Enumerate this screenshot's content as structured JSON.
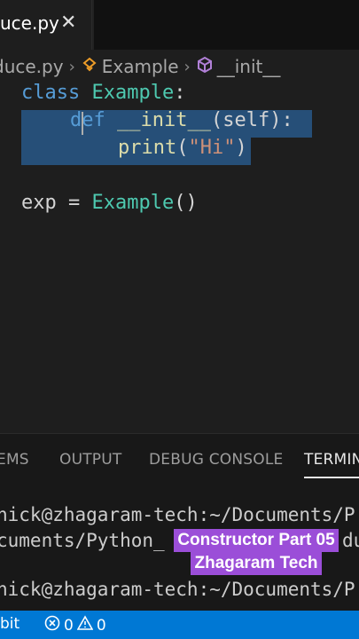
{
  "tab": {
    "label": "uce.py",
    "close": "✕"
  },
  "breadcrumb": {
    "file": "duce.py",
    "sep": "›",
    "class_icon": "symbol-class-icon",
    "class": "Example",
    "method_icon": "symbol-method-icon",
    "method": "__init__"
  },
  "code": {
    "line1": {
      "kw": "class",
      "name": "Example",
      "colon": ":"
    },
    "line2": {
      "kw": "def",
      "name": "__init__",
      "rest": "(self):"
    },
    "line3": {
      "fn": "print",
      "open": "(",
      "str": "\"Hi\"",
      "close": ")"
    },
    "line5": {
      "var": "exp",
      "eq": "=",
      "cls": "Example",
      "call": "()"
    }
  },
  "panel": {
    "tabs": [
      "EMS",
      "OUTPUT",
      "DEBUG CONSOLE",
      "TERMIN"
    ],
    "active_tab": "TERMIN",
    "terminal": [
      "nick@zhagaram-tech:~/Documents/P",
      "cuments/Python_",
      "nick@zhagaram-tech:~/Documents/P"
    ],
    "terminal_tail": "du"
  },
  "overlay": {
    "line1": "Constructor Part 05",
    "line2": "Zhagaram Tech"
  },
  "statusbar": {
    "branch": "bit",
    "errors": "0",
    "warnings": "0"
  },
  "colors": {
    "statusbar": "#0078d4",
    "selection": "#264f78",
    "overlay": "#9b4ed8"
  }
}
